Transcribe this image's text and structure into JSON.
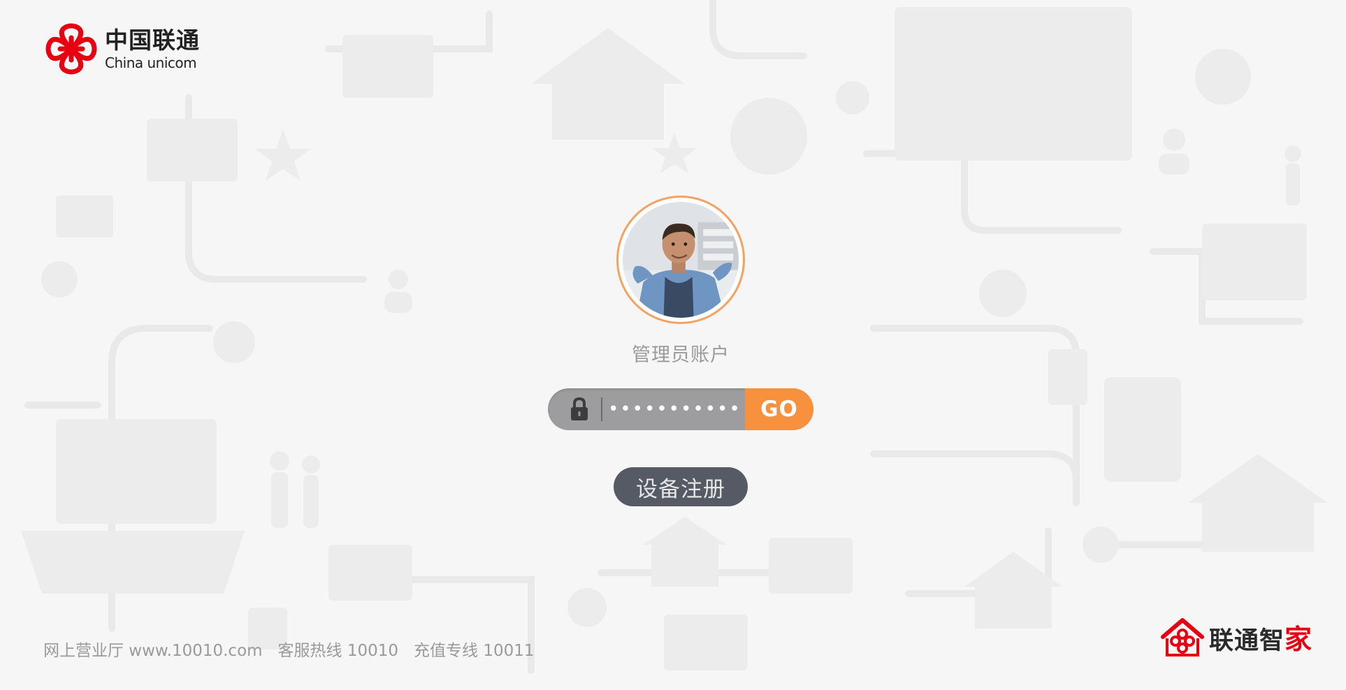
{
  "brand": {
    "name_cn": "中国联通",
    "name_en": "China unicom",
    "accent_color": "#e60012"
  },
  "login": {
    "account_label": "管理员账户",
    "password_value": "••••••••••••••",
    "go_label": "GO",
    "register_label": "设备注册",
    "accent_color": "#f7913e"
  },
  "footer": {
    "links": [
      "网上营业厅 www.10010.com",
      "客服热线 10010",
      "充值专线 10011"
    ]
  },
  "bottom_brand": {
    "name_main": "联通智",
    "name_accent": "家"
  },
  "icons": {
    "logo": "china-unicom-knot-icon",
    "avatar": "user-avatar",
    "lock": "lock-icon",
    "home_logo": "smart-home-icon"
  }
}
